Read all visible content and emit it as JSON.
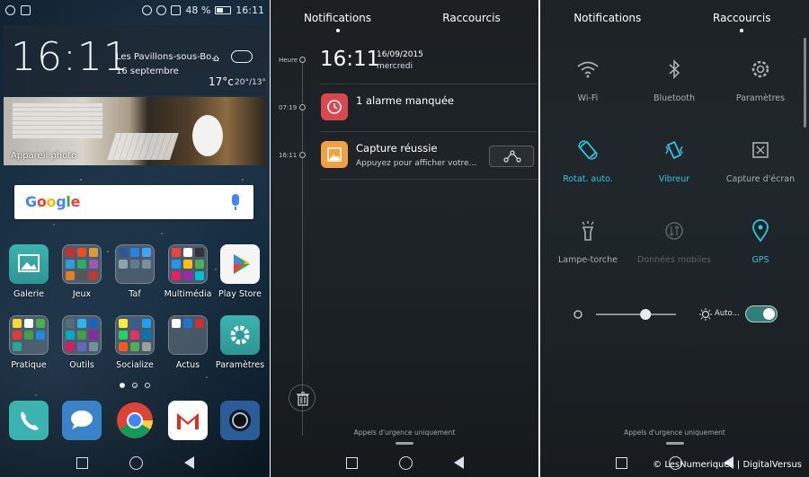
{
  "home": {
    "status": {
      "battery": "48 %",
      "time": "16:11"
    },
    "clock_widget": {
      "time": "16:11",
      "city": "Les Pavillons-sous-Bo...",
      "date": "16 septembre",
      "temp": "17°c",
      "range": "20°/13°"
    },
    "photo_widget": {
      "label": "Appareil photo"
    },
    "search": {
      "logo": "Google"
    },
    "apps_row1": [
      {
        "label": "Galerie"
      },
      {
        "label": "Jeux"
      },
      {
        "label": "Taf"
      },
      {
        "label": "Multimédia"
      },
      {
        "label": "Play Store"
      }
    ],
    "apps_row2": [
      {
        "label": "Pratique"
      },
      {
        "label": "Outils"
      },
      {
        "label": "Socialize"
      },
      {
        "label": "Actus"
      },
      {
        "label": "Paramètres"
      }
    ],
    "dock": [
      {
        "icon": "phone-icon"
      },
      {
        "icon": "messages-icon"
      },
      {
        "icon": "chrome-icon"
      },
      {
        "icon": "gmail-icon"
      },
      {
        "icon": "camera-icon"
      }
    ]
  },
  "notifications": {
    "tabs": [
      "Notifications",
      "Raccourcis"
    ],
    "timeline_labels": [
      "Heure",
      "07:19",
      "16:11"
    ],
    "time": "16:11",
    "date": "16/09/2015",
    "day": "mercredi",
    "items": [
      {
        "title": "1 alarme manquée",
        "subtitle": ""
      },
      {
        "title": "Capture réussie",
        "subtitle": "Appuyez pour afficher votre..."
      }
    ],
    "emergency": "Appels d'urgence uniquement"
  },
  "shortcuts": {
    "tabs": [
      "Notifications",
      "Raccourcis"
    ],
    "toggles": [
      {
        "label": "Wi-Fi",
        "state": "default"
      },
      {
        "label": "Bluetooth",
        "state": "default"
      },
      {
        "label": "Paramètres",
        "state": "default"
      },
      {
        "label": "Rotat. auto.",
        "state": "on"
      },
      {
        "label": "Vibreur",
        "state": "on"
      },
      {
        "label": "Capture d'écran",
        "state": "default"
      },
      {
        "label": "Lampe-torche",
        "state": "default"
      },
      {
        "label": "Données mobiles",
        "state": "off"
      },
      {
        "label": "GPS",
        "state": "on"
      }
    ],
    "brightness": {
      "level": 0.62,
      "auto_label": "Auto...",
      "auto_enabled": true
    },
    "emergency": "Appels d'urgence uniquement"
  },
  "watermark": "© LesNumeriques | DigitalVersus",
  "colors": {
    "accent": "#2cc7e6",
    "toggle_on": "#2f7f7a"
  }
}
